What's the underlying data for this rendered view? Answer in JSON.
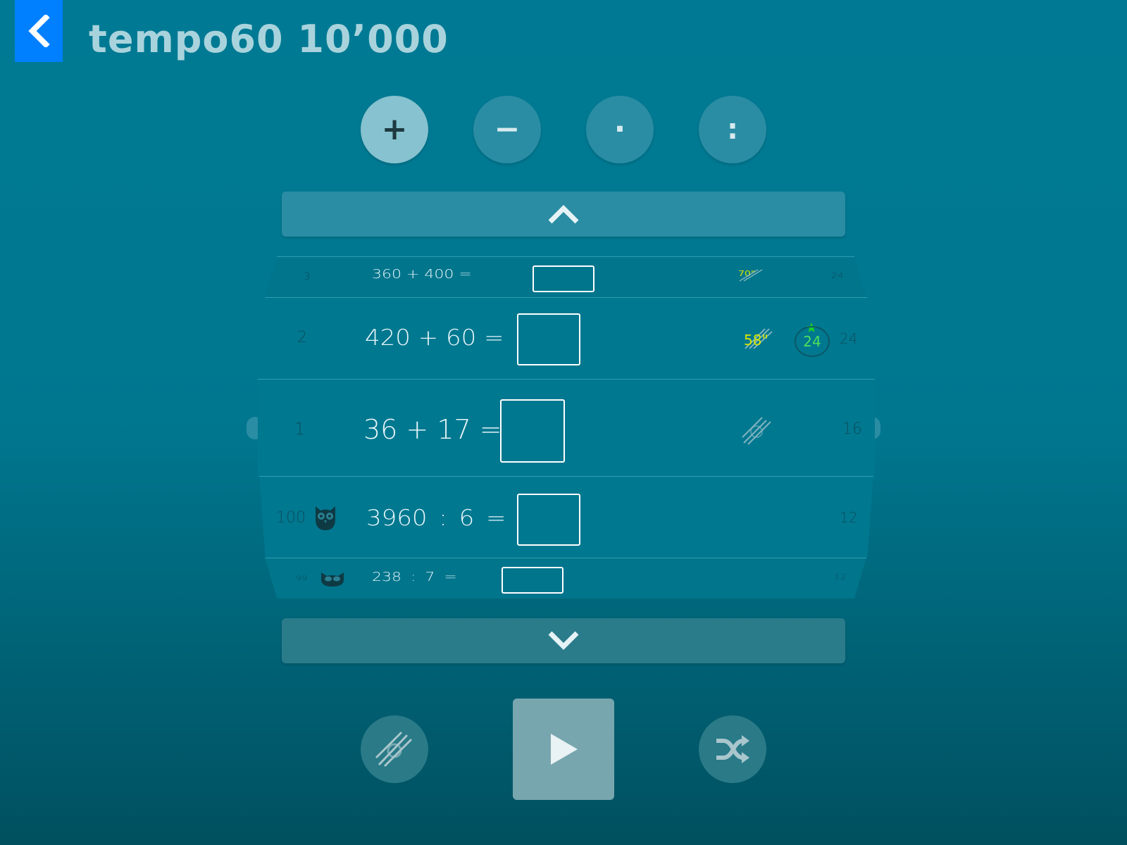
{
  "header": {
    "title": "tempo60 10’000"
  },
  "operations": {
    "plus": "+",
    "minus": "−",
    "times": "·",
    "divide": ":"
  },
  "rows": [
    {
      "index": "3",
      "expression": "360 + 400 =",
      "time": "70\"",
      "score": "24"
    },
    {
      "index": "2",
      "expression": "420 + 60 =",
      "time": "58\"",
      "best": "24",
      "score": "24"
    },
    {
      "index": "1",
      "expression": "36 + 17 =",
      "score": "16"
    },
    {
      "index": "100",
      "expression": "3960 : 6 =",
      "score": "12"
    },
    {
      "index": "99",
      "expression": "238 : 7 =",
      "score": "12"
    }
  ],
  "colors": {
    "accent": "#0080ff",
    "time_badge": "#d8e600",
    "best_score": "#4de05a"
  },
  "icons": {
    "back": "chevron-left-icon",
    "scroll_up": "chevron-up-icon",
    "scroll_down": "chevron-down-icon",
    "row_owl": "owl-icon",
    "timer": "tempo-stripes-icon",
    "play": "play-icon",
    "shuffle": "shuffle-icon"
  }
}
